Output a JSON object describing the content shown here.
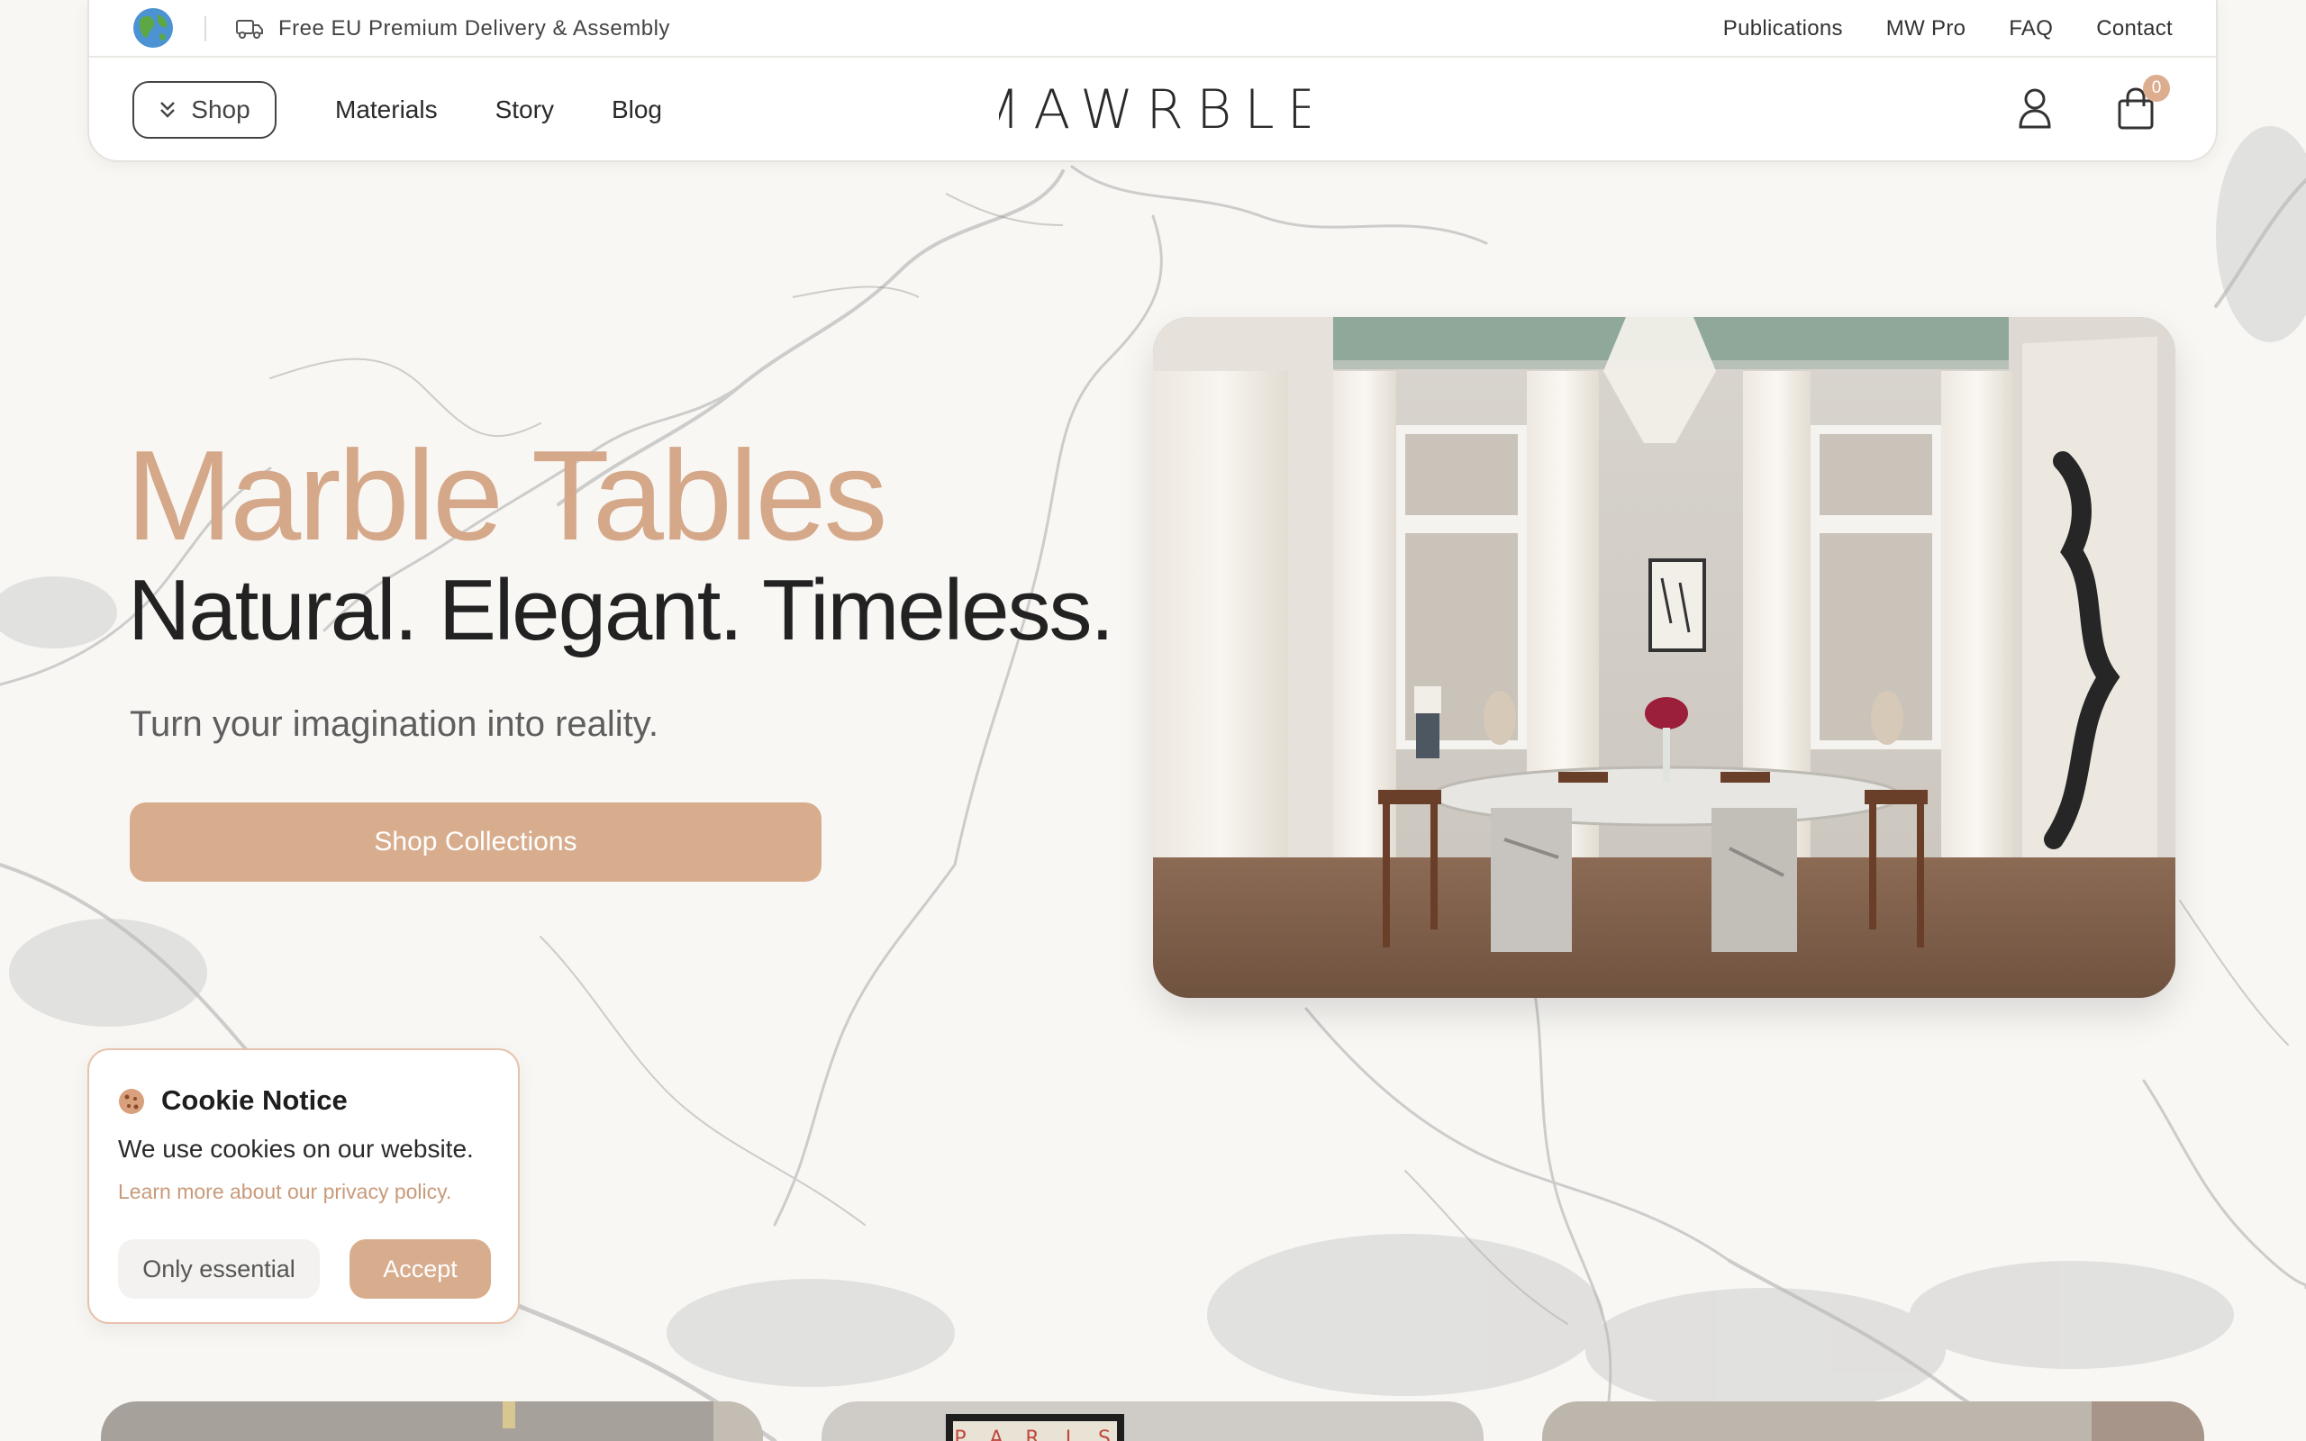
{
  "header": {
    "promo": "Free EU Premium Delivery & Assembly",
    "top_links": [
      "Publications",
      "MW Pro",
      "FAQ",
      "Contact"
    ],
    "shop_label": "Shop",
    "nav_links": [
      "Materials",
      "Story",
      "Blog"
    ],
    "logo_text": "MAWRBLE",
    "cart_count": "0"
  },
  "hero": {
    "title": "Marble Tables",
    "tagline": "Natural. Elegant. Timeless.",
    "subtitle": "Turn your imagination into reality.",
    "cta_label": "Shop Collections"
  },
  "cookie": {
    "title": "Cookie Notice",
    "text": "We use cookies on our website.",
    "link": "Learn more about our privacy policy.",
    "essential_label": "Only essential",
    "accept_label": "Accept"
  },
  "peek": {
    "poster_letters": [
      "P",
      "A",
      "R",
      "I",
      "S"
    ]
  },
  "colors": {
    "accent": "#d8ad8e",
    "title_accent": "#d5a88a",
    "background": "#f7f6f3"
  }
}
